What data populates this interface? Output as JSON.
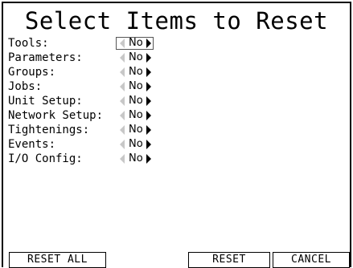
{
  "screen": {
    "title": "Select Items to Reset"
  },
  "items": [
    {
      "label": "Tools:",
      "value": "No"
    },
    {
      "label": "Parameters:",
      "value": "No"
    },
    {
      "label": "Groups:",
      "value": "No"
    },
    {
      "label": "Jobs:",
      "value": "No"
    },
    {
      "label": "Unit Setup:",
      "value": "No"
    },
    {
      "label": "Network Setup:",
      "value": "No"
    },
    {
      "label": "Tightenings:",
      "value": "No"
    },
    {
      "label": "Events:",
      "value": "No"
    },
    {
      "label": "I/O Config:",
      "value": "No"
    }
  ],
  "buttons": {
    "reset_all": "RESET ALL",
    "reset": "RESET",
    "cancel": "CANCEL"
  },
  "icons": {
    "decrease": "left-arrow-icon",
    "increase": "right-arrow-icon"
  },
  "colors": {
    "background": "#ffffff",
    "text": "#000000",
    "disabled_arrow": "#c8c8c8",
    "focus_border": "#555555"
  }
}
